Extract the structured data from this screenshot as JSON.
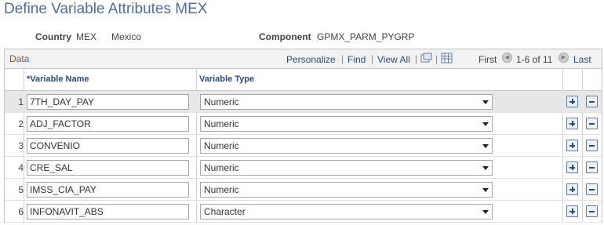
{
  "page": {
    "title": "Define Variable Attributes MEX",
    "country_label": "Country",
    "country_code": "MEX",
    "country_name": "Mexico",
    "component_label": "Component",
    "component_value": "GPMX_PARM_PYGRP"
  },
  "grid": {
    "caption": "Data",
    "personalize": "Personalize",
    "find": "Find",
    "view_all": "View All",
    "first": "First",
    "range": "1-6 of 11",
    "last": "Last",
    "separator": "|",
    "icons": [
      "zoom-icon",
      "download-grid-icon",
      "previous-arrow-icon",
      "next-arrow-icon"
    ],
    "columns": {
      "variable_name": "*Variable Name",
      "variable_type": "Variable Type"
    },
    "rows": [
      {
        "num": "1",
        "name": "7TH_DAY_PAY",
        "type": "Numeric"
      },
      {
        "num": "2",
        "name": "ADJ_FACTOR",
        "type": "Numeric"
      },
      {
        "num": "3",
        "name": "CONVENIO",
        "type": "Numeric"
      },
      {
        "num": "4",
        "name": "CRE_SAL",
        "type": "Numeric"
      },
      {
        "num": "5",
        "name": "IMSS_CIA_PAY",
        "type": "Numeric"
      },
      {
        "num": "6",
        "name": "INFONAVIT_ABS",
        "type": "Character"
      }
    ]
  },
  "colors": {
    "title": "#4f6d9a",
    "caption": "#b34a00",
    "link": "#2e4a7d",
    "selected_row": "#e7e7e7"
  }
}
